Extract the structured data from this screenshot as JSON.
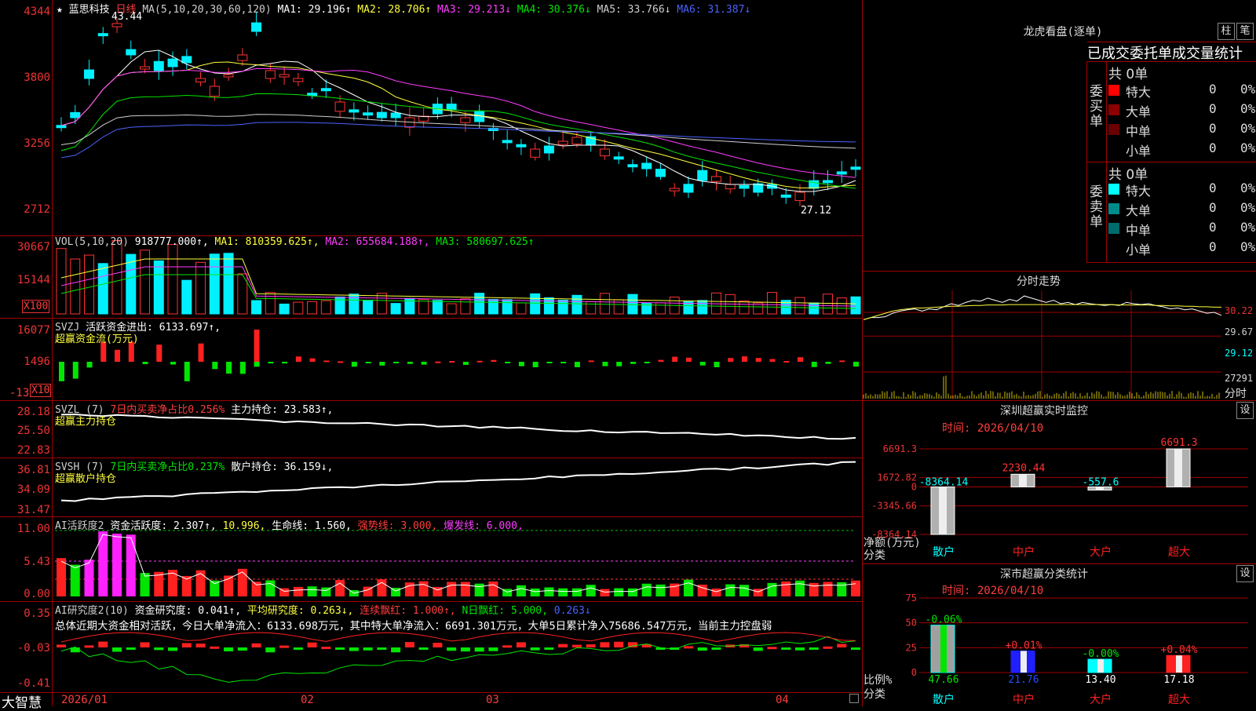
{
  "app_brand": "大智慧",
  "main": {
    "star": "★",
    "stock_name": "蓝思科技",
    "period": "日线",
    "ma_header": "MA(5,10,20,30,60,120)",
    "ma": [
      "MA1: 29.196↑",
      "MA2: 28.706↑",
      "MA3: 29.213↓",
      "MA4: 30.376↓",
      "MA5: 33.766↓",
      "MA6: 31.387↓"
    ],
    "y_ticks": [
      "4344",
      "3800",
      "3256",
      "2712"
    ],
    "high_label": "43.44",
    "low_label": "27.12"
  },
  "vol": {
    "header": "VOL(5,10,20)",
    "value": "918777.000↑,",
    "ma": [
      "MA1: 810359.625↑,",
      "MA2: 655684.188↑,",
      "MA3: 580697.625↑"
    ],
    "y_ticks": [
      "30667",
      "15144"
    ],
    "unit": "X100"
  },
  "svzj": {
    "header": "SVZJ",
    "label": "活跃资金进出: 6133.697↑,",
    "sub": "超赢资金流(万元)",
    "y_ticks": [
      "16077",
      "1496",
      "-13"
    ],
    "unit": "X10"
  },
  "svzl": {
    "header": "SVZL (7)",
    "label1": "7日内买卖净占比0.256%",
    "label2": "主力持仓: 23.583↑,",
    "sub": "超赢主力持仓",
    "y_ticks": [
      "28.18",
      "25.50",
      "22.83"
    ]
  },
  "svsh": {
    "header": "SVSH (7)",
    "label1": "7日内买卖净占比0.237%",
    "label2": "散户持仓: 36.159↓,",
    "sub": "超赢散户持仓",
    "y_ticks": [
      "36.81",
      "34.09",
      "31.47"
    ]
  },
  "ai1": {
    "header": "AI活跃度2",
    "items": [
      "资金活跃度: 2.307↑,",
      "10.996,",
      "生命线: 1.560,",
      "强势线: 3.000,",
      "爆发线: 6.000,"
    ],
    "y_ticks": [
      "11.00",
      "5.43",
      "0.00"
    ]
  },
  "ai2": {
    "header": "AI研究度2(10)",
    "items": [
      "资金研究度: 0.041↑,",
      "平均研究度: 0.263↓,",
      "连续飘红: 1.000↑,",
      "N日飘红: 5.000,",
      "0.263↓"
    ],
    "summary": "总体近期大资金相对活跃，今日大单净流入：6133.698万元，其中特大单净流入：6691.301万元，大单5日累计净入75686.547万元，当前主力控盘弱",
    "y_ticks": [
      "0.35",
      "-0.03",
      "-0.41"
    ]
  },
  "dates": [
    "2026/01",
    "02",
    "03",
    "04"
  ],
  "longhu": {
    "title": "龙虎看盘(逐单)",
    "btn_bar": "柱",
    "btn_note": "笔",
    "tabs_label": "已成交委托单成交量统计",
    "buy": {
      "side": "委买单",
      "total": "共 0单",
      "rows": [
        {
          "name": "特大",
          "count": "0",
          "pct": "0%",
          "color": "#ff0000"
        },
        {
          "name": "大单",
          "count": "0",
          "pct": "0%",
          "color": "#8b0000"
        },
        {
          "name": "中单",
          "count": "0",
          "pct": "0%",
          "color": "#6a0000"
        },
        {
          "name": "小单",
          "count": "0",
          "pct": "0%",
          "color": "#000000"
        }
      ]
    },
    "sell": {
      "side": "委卖单",
      "total": "共 0单",
      "rows": [
        {
          "name": "特大",
          "count": "0",
          "pct": "0%",
          "color": "#00ffff"
        },
        {
          "name": "大单",
          "count": "0",
          "pct": "0%",
          "color": "#008b8b"
        },
        {
          "name": "中单",
          "count": "0",
          "pct": "0%",
          "color": "#006b6b"
        },
        {
          "name": "小单",
          "count": "0",
          "pct": "0%",
          "color": "#000000"
        }
      ]
    }
  },
  "intraday": {
    "title": "分时走势",
    "prices": [
      "30.22",
      "29.67",
      "29.12"
    ],
    "vol": "27291",
    "vol_label": "分时",
    "line": [
      30.05,
      30.1,
      30.1,
      30.12,
      30.2,
      30.25,
      30.28,
      30.3,
      30.25,
      30.3,
      30.28,
      30.35,
      30.42,
      30.38,
      30.45,
      30.5,
      30.48,
      30.55,
      30.5,
      30.45,
      30.52,
      30.48,
      30.6,
      30.55,
      30.5,
      30.45,
      30.5,
      30.42,
      30.45,
      30.4,
      30.45,
      30.42,
      30.4,
      30.38,
      30.4,
      30.38,
      30.45,
      30.42,
      30.4,
      30.42,
      30.38,
      30.35,
      30.3,
      30.32,
      30.28,
      30.3,
      30.25,
      30.2,
      30.22,
      30.15
    ],
    "avg": [
      30.05,
      30.1,
      30.15,
      30.2,
      30.25,
      30.28,
      30.3,
      30.32,
      30.32,
      30.33,
      30.34,
      30.35,
      30.36,
      30.36,
      30.37,
      30.38,
      30.38,
      30.39,
      30.39,
      30.39,
      30.4,
      30.4,
      30.4,
      30.4,
      30.4,
      30.4,
      30.4,
      30.4,
      30.4,
      30.4,
      30.4,
      30.4,
      30.4,
      30.4,
      30.4,
      30.39,
      30.39,
      30.39,
      30.39,
      30.39,
      30.38,
      30.38,
      30.37,
      30.37,
      30.36,
      30.36,
      30.35,
      30.35,
      30.34,
      30.34
    ]
  },
  "monitor": {
    "title": "深圳超赢实时监控",
    "btn": "设",
    "time": "时间: 2026/04/10",
    "y_ticks": [
      "6691.3",
      "1672.82",
      "0",
      "-3345.66",
      "-8364.14"
    ],
    "ylabel": "净额(万元)",
    "xlabel": "分类",
    "chart_data": {
      "type": "bar",
      "categories": [
        "散户",
        "中户",
        "大户",
        "超大"
      ],
      "values": [
        -8364.14,
        2230.44,
        -557.6,
        6691.3
      ],
      "ylim": [
        -8364.14,
        6691.3
      ],
      "ylabel": "净额(万元)",
      "xlabel": "分类"
    }
  },
  "classify": {
    "title": "深市超赢分类统计",
    "btn": "设",
    "time": "时间: 2026/04/10",
    "y_ticks": [
      "75",
      "50",
      "25",
      "0"
    ],
    "ylabel": "比例%",
    "xlabel": "分类",
    "chart_data": {
      "type": "bar",
      "categories": [
        "散户",
        "中户",
        "大户",
        "超大"
      ],
      "values": [
        47.66,
        21.76,
        13.4,
        17.18
      ],
      "changes": [
        "-0.06%",
        "+0.01%",
        "-0.00%",
        "+0.04%"
      ],
      "ylim": [
        0,
        75
      ],
      "ylabel": "比例%",
      "xlabel": "分类"
    }
  }
}
